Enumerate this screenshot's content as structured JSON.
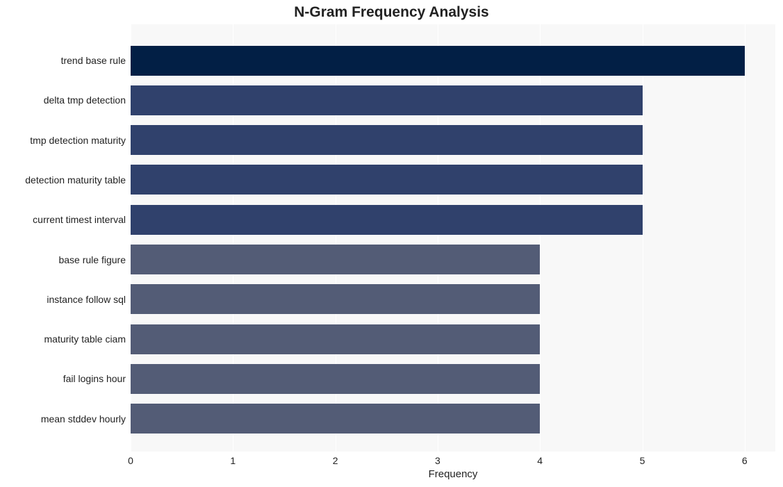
{
  "chart_data": {
    "type": "bar",
    "orientation": "horizontal",
    "title": "N-Gram Frequency Analysis",
    "xlabel": "Frequency",
    "ylabel": "",
    "xlim": [
      0,
      6.3
    ],
    "xticks": [
      0,
      1,
      2,
      3,
      4,
      5,
      6
    ],
    "categories": [
      "trend base rule",
      "delta tmp detection",
      "tmp detection maturity",
      "detection maturity table",
      "current timest interval",
      "base rule figure",
      "instance follow sql",
      "maturity table ciam",
      "fail logins hour",
      "mean stddev hourly"
    ],
    "values": [
      6,
      5,
      5,
      5,
      5,
      4,
      4,
      4,
      4,
      4
    ],
    "bar_colors": [
      "#021f45",
      "#30416c",
      "#30416c",
      "#30416c",
      "#30416c",
      "#535c76",
      "#535c76",
      "#535c76",
      "#535c76",
      "#535c76"
    ]
  }
}
